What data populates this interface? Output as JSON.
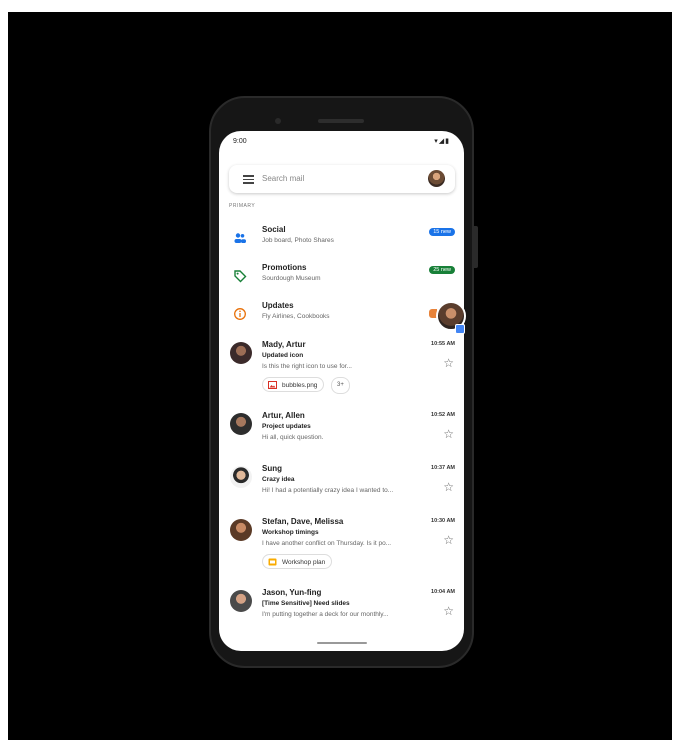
{
  "status_bar": {
    "time": "9:00",
    "icons": "▾◢▮"
  },
  "search": {
    "placeholder": "Search mail"
  },
  "section_label": "PRIMARY",
  "categories": [
    {
      "title": "Social",
      "subtitle": "Job board, Photo Shares",
      "badge": "15 new",
      "badge_color": "#1a73e8",
      "icon": "people-icon",
      "icon_color": "#1a73e8"
    },
    {
      "title": "Promotions",
      "subtitle": "Sourdough Museum",
      "badge": "25 new",
      "badge_color": "#188038",
      "icon": "tag-icon",
      "icon_color": "#188038"
    },
    {
      "title": "Updates",
      "subtitle": "Fly Airlines, Cookbooks",
      "badge": "",
      "badge_color": "#e8710a",
      "icon": "info-icon",
      "icon_color": "#e8710a"
    }
  ],
  "emails": [
    {
      "sender": "Mady, Artur",
      "time": "10:55 AM",
      "subject": "Updated icon",
      "snippet": "Is this the right icon to use for...",
      "attachment": "bubbles.png",
      "attachment_icon": "image-file-icon",
      "more": "3+"
    },
    {
      "sender": "Artur, Allen",
      "time": "10:52 AM",
      "subject": "Project updates",
      "snippet": "Hi all, quick question."
    },
    {
      "sender": "Sung",
      "time": "10:37 AM",
      "subject": "Crazy idea",
      "snippet": "Hi! I had a potentially crazy idea I wanted to..."
    },
    {
      "sender": "Stefan, Dave, Melissa",
      "time": "10:30 AM",
      "subject": "Workshop timings",
      "snippet": "I have another conflict on Thursday. Is it po...",
      "attachment": "Workshop plan",
      "attachment_icon": "slides-icon"
    },
    {
      "sender": "Jason, Yun-fing",
      "time": "10:04 AM",
      "subject": "[Time Sensitive] Need slides",
      "snippet": "I'm putting together a deck for our monthly..."
    }
  ]
}
